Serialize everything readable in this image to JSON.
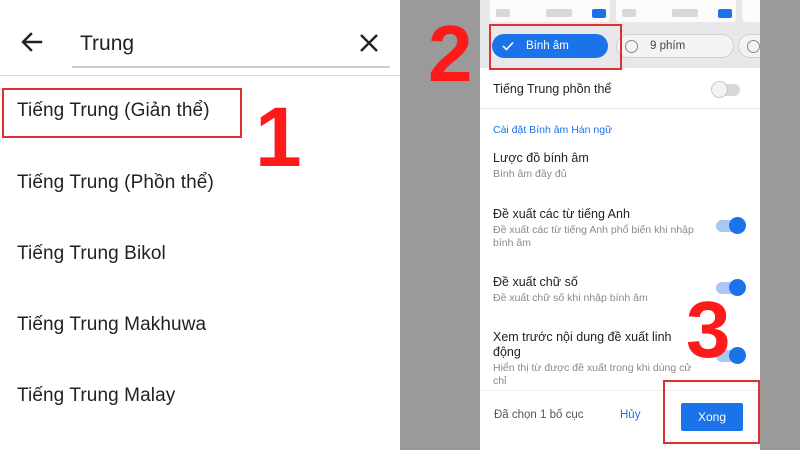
{
  "search": {
    "value": "Trung"
  },
  "languages": [
    "Tiếng Trung (Giản thể)",
    "Tiếng Trung (Phồn thể)",
    "Tiếng Trung Bikol",
    "Tiếng Trung Makhuwa",
    "Tiếng Trung Malay"
  ],
  "markers": [
    "1",
    "2",
    "3"
  ],
  "layout_options": {
    "binh_am": "Bính âm",
    "nine_keys": "9 phím"
  },
  "settings": {
    "traditional": {
      "title": "Tiếng Trung phồn thể",
      "enabled": false
    },
    "section_header": "Cài đặt Bính âm Hán ngữ",
    "pinyin_scheme": {
      "title": "Lược đồ bính âm",
      "sub": "Bính âm đầy đủ"
    },
    "english_suggest": {
      "title": "Đề xuất các từ tiếng Anh",
      "sub": "Đề xuất các từ tiếng Anh phổ biến khi nhập bính âm",
      "enabled": true
    },
    "digit_suggest": {
      "title": "Đề xuất chữ số",
      "sub": "Đề xuất chữ số khi nhập bính âm",
      "enabled": true
    },
    "dynamic_preview": {
      "title": "Xem trước nội dung đề xuất linh động",
      "sub": "Hiển thị từ được đề xuất trong khi dùng cử chỉ",
      "enabled": true
    }
  },
  "bottom": {
    "selected": "Đã chọn 1 bố cục",
    "cancel": "Hủy",
    "done": "Xong"
  },
  "colors": {
    "accent": "#1a73e8",
    "marker_red": "#ff1a1a"
  }
}
